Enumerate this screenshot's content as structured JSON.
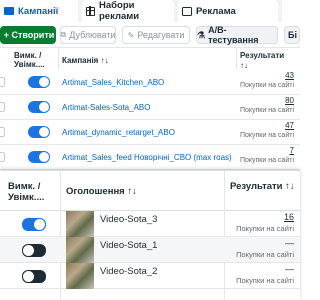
{
  "tabs": [
    {
      "label": "Кампанії",
      "icon": "folder-icon"
    },
    {
      "label": "Набори реклами",
      "icon": "grid-icon"
    },
    {
      "label": "Реклама",
      "icon": "ad-card-icon"
    }
  ],
  "toolbar": {
    "create_label": "+ Створити",
    "duplicate_label": "Дублювати",
    "edit_label": "Редагувати",
    "ab_label": "A/B-тестування",
    "more_label": "Бі"
  },
  "campaigns_table": {
    "headers": {
      "toggle": "Вимк. / Увімк....",
      "name": "Кампанія ↑↓",
      "results": "Результати ↑↓"
    },
    "rows": [
      {
        "name": "Artimat_Sales_Kitchen_ABO",
        "result": "43",
        "result_type": "Покупки на сайті",
        "on": true
      },
      {
        "name": "Artimat-Sales-Sota_ABO",
        "result": "80",
        "result_type": "Покупки на сайті",
        "on": true
      },
      {
        "name": "Artimat_dynamic_retarget_ABO",
        "result": "47",
        "result_type": "Покупки на сайті",
        "on": true
      },
      {
        "name": "Artimat_Sales_feed Новорічні_CBO (max roas)",
        "result": "7",
        "result_type": "Покупки на сайті",
        "on": true
      }
    ]
  },
  "ads_panel": {
    "headers": {
      "toggle": "Вимк. / Увімк....",
      "name": "Оголошення ↑↓",
      "results": "Результати ↑↓"
    },
    "rows": [
      {
        "name": "Video-Sota_3",
        "result": "16",
        "result_type": "Покупки на сайті",
        "on": true
      },
      {
        "name": "Video-Sota_1",
        "result": "—",
        "result_type": "Покупки на сайті",
        "on": false
      },
      {
        "name": "Video-Sota_2",
        "result": "—",
        "result_type": "Покупки на сайті",
        "on": false
      }
    ]
  },
  "colors": {
    "accent": "#0064d1",
    "create": "#0a7c32",
    "toggle_on": "#1b74e4",
    "toggle_off": "#1c2b33"
  }
}
